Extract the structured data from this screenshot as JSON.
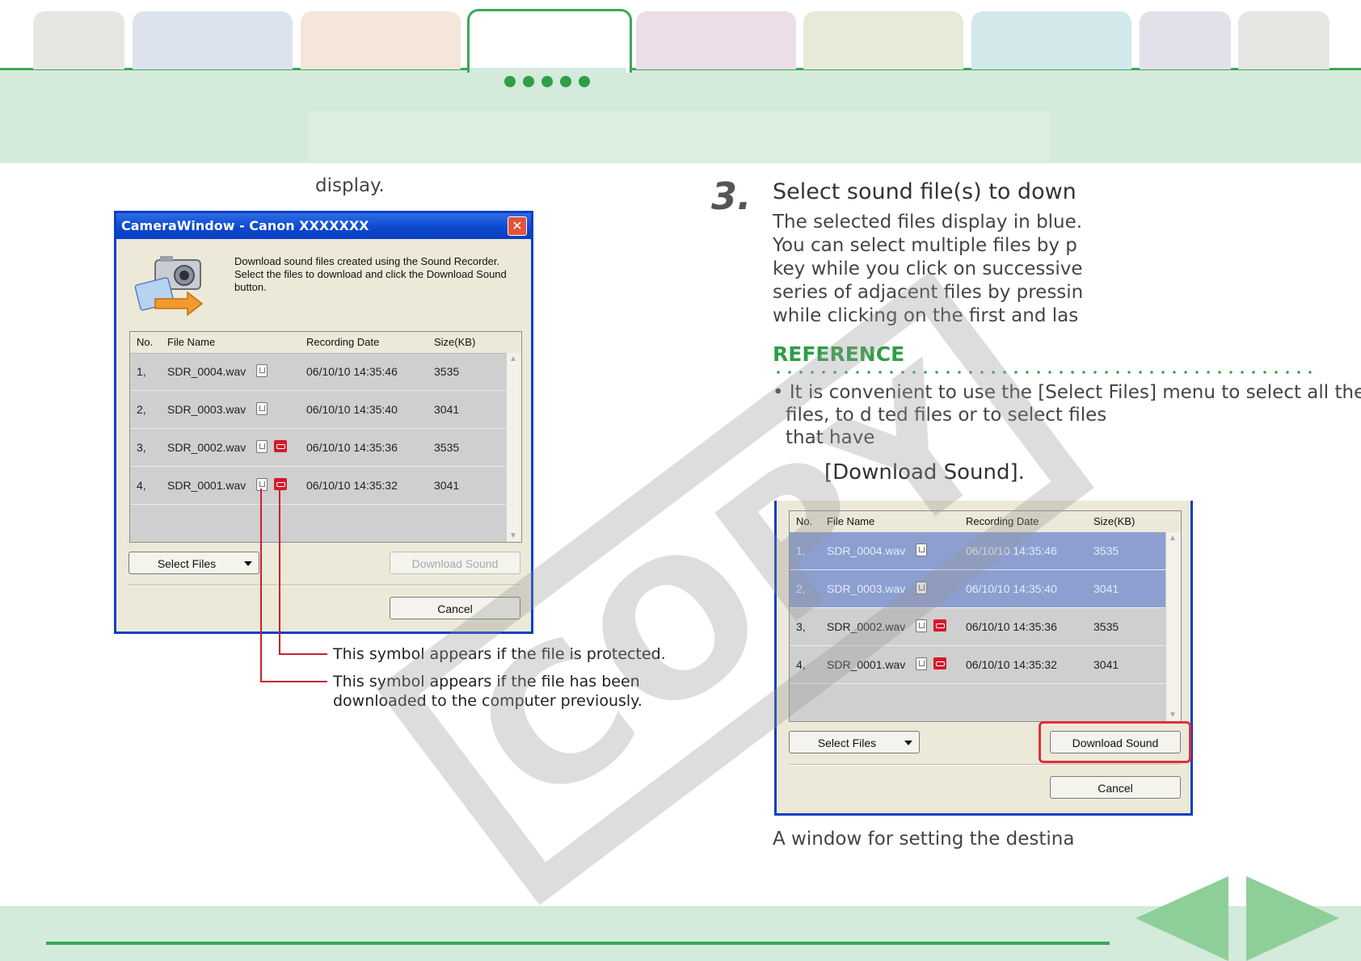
{
  "tabs": [
    {
      "color": "#e6e6e3"
    },
    {
      "color": "#dde3ee"
    },
    {
      "color": "#f4e6d8"
    },
    {
      "color": "#ffffff",
      "active": true
    },
    {
      "color": "#ecdde6"
    },
    {
      "color": "#e6ead6"
    },
    {
      "color": "#d3e8ea"
    },
    {
      "color": "#e2e1e9"
    },
    {
      "color": "#e6e6e3"
    }
  ],
  "left": {
    "display_text": "display.",
    "dialog": {
      "title": "CameraWindow - Canon XXXXXXX",
      "close": "✕",
      "intro_lines": [
        "Download sound files created using the Sound Recorder.",
        "Select the files to download and click the Download Sound",
        "button."
      ],
      "headers": {
        "no": "No.",
        "file": "File Name",
        "date": "Recording Date",
        "size": "Size(KB)"
      },
      "rows": [
        {
          "no": "1,",
          "file": "SDR_0004.wav",
          "date": "06/10/10 14:35:46",
          "size": "3535"
        },
        {
          "no": "2,",
          "file": "SDR_0003.wav",
          "date": "06/10/10 14:35:40",
          "size": "3041"
        },
        {
          "no": "3,",
          "file": "SDR_0002.wav",
          "date": "06/10/10 14:35:36",
          "size": "3535"
        },
        {
          "no": "4,",
          "file": "SDR_0001.wav",
          "date": "06/10/10 14:35:32",
          "size": "3041"
        }
      ],
      "select_files": "Select Files",
      "download_sound": "Download Sound",
      "cancel": "Cancel"
    },
    "callouts": {
      "protected": "This symbol appears if the file is protected.",
      "downloaded_1": "This symbol appears if the file has been",
      "downloaded_2": "downloaded to the computer previously."
    }
  },
  "right": {
    "step_number": "3.",
    "step_title": "Select sound file(s) to down",
    "step_lines": [
      "The selected files display in blue.",
      "You can select multiple files by p",
      "key while you click on successive",
      "series of adjacent files by pressin",
      "while clicking on the first and las"
    ],
    "reference_title": "REFERENCE",
    "reference_lines": [
      "• It is convenient to use the [Select Files] menu to select all the",
      "files, to d                                  ted files or to select files",
      "that have"
    ],
    "download_sound_text": "[Download Sound].",
    "dialog": {
      "headers": {
        "no": "No.",
        "file": "File Name",
        "date": "Recording Date",
        "size": "Size(KB)"
      },
      "rows": [
        {
          "no": "1,",
          "file": "SDR_0004.wav",
          "date": "06/10/10 14:35:46",
          "size": "3535",
          "selected": true
        },
        {
          "no": "2,",
          "file": "SDR_0003.wav",
          "date": "06/10/10 14:35:40",
          "size": "3041",
          "selected": true
        },
        {
          "no": "3,",
          "file": "SDR_0002.wav",
          "date": "06/10/10 14:35:36",
          "size": "3535",
          "selected": false
        },
        {
          "no": "4,",
          "file": "SDR_0001.wav",
          "date": "06/10/10 14:35:32",
          "size": "3041",
          "selected": false
        }
      ],
      "select_files": "Select Files",
      "download_sound": "Download Sound",
      "cancel": "Cancel"
    },
    "bottom_caption": "A window for setting the destina"
  },
  "watermark": "COPY",
  "colors": {
    "accent": "#3aa857",
    "highlight": "#e0303b",
    "selection": "#8c9fd0",
    "title_bar": "#0b3fc4"
  }
}
